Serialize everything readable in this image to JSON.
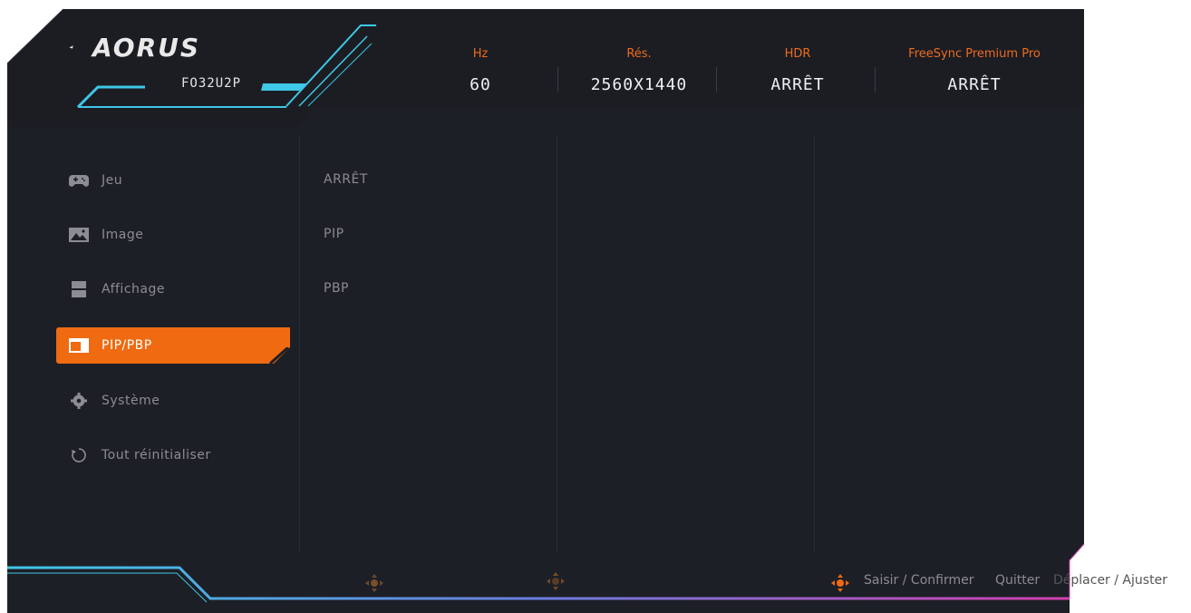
{
  "brand": {
    "logo_text": "AORUS",
    "model": "FO32U2P"
  },
  "status": [
    {
      "label": "Hz",
      "value": "60"
    },
    {
      "label": "Rés.",
      "value": "2560X1440"
    },
    {
      "label": "HDR",
      "value": "ARRÊT"
    },
    {
      "label": "FreeSync Premium Pro",
      "value": "ARRÊT"
    }
  ],
  "menu": {
    "items": [
      {
        "label": "Jeu",
        "icon": "gamepad-icon"
      },
      {
        "label": "Image",
        "icon": "picture-icon"
      },
      {
        "label": "Affichage",
        "icon": "display-icon"
      },
      {
        "label": "PIP/PBP",
        "icon": "pip-icon",
        "active": true
      },
      {
        "label": "Système",
        "icon": "gear-icon"
      },
      {
        "label": "Tout réinitialiser",
        "icon": "reset-icon"
      }
    ]
  },
  "submenu": {
    "items": [
      "ARRÊT",
      "PIP",
      "PBP"
    ]
  },
  "footer": {
    "hint_enter": "Saisir / Confirmer",
    "hint_exit": "Quitter",
    "hint_move": "Déplacer / Ajuster"
  },
  "colors": {
    "accent": "#ef6a10",
    "cyan": "#3ec7e6",
    "magenta": "#d43fb0",
    "panel": "#1d1f26"
  }
}
